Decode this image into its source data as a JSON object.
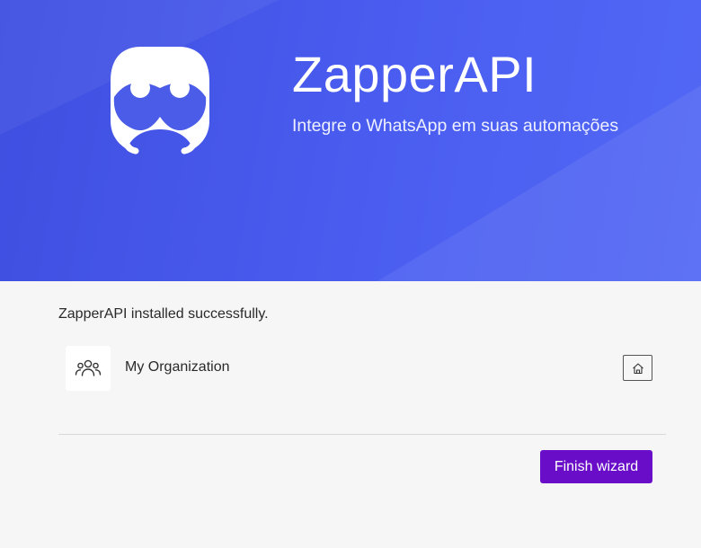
{
  "app": {
    "brand_name": "ZapperAPI",
    "tagline": "Integre o WhatsApp em suas automações",
    "logo_icon": "robot-face-icon",
    "hero_color": "#4a5df0"
  },
  "status": {
    "message": "ZapperAPI installed successfully."
  },
  "organization": {
    "name": "My Organization",
    "avatar_icon": "people-group-icon",
    "home_icon": "home-icon"
  },
  "actions": {
    "finish_label": "Finish wizard",
    "finish_color": "#6a0dc9"
  }
}
